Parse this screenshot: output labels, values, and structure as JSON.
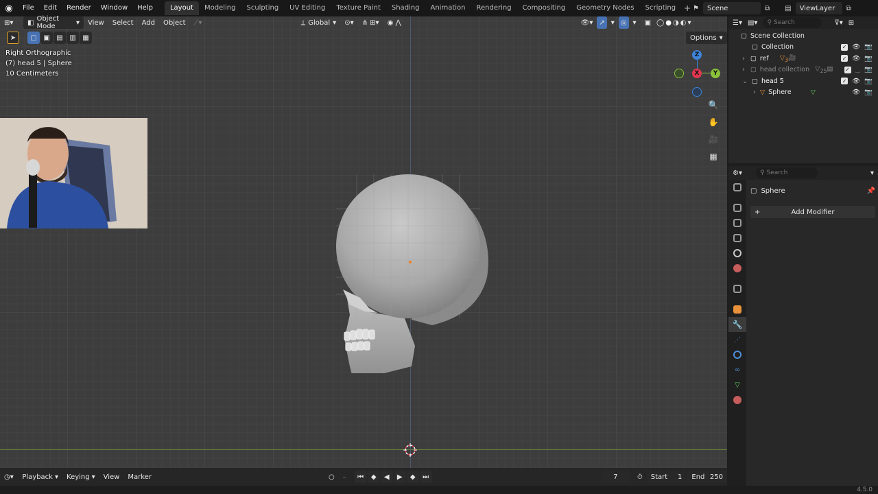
{
  "menu": [
    "File",
    "Edit",
    "Render",
    "Window",
    "Help"
  ],
  "workspaces": [
    "Layout",
    "Modeling",
    "Sculpting",
    "UV Editing",
    "Texture Paint",
    "Shading",
    "Animation",
    "Rendering",
    "Compositing",
    "Geometry Nodes",
    "Scripting"
  ],
  "active_workspace": "Layout",
  "scene": "Scene",
  "view_layer": "ViewLayer",
  "viewport": {
    "mode": "Object Mode",
    "menus": [
      "View",
      "Select",
      "Add",
      "Object"
    ],
    "orientation": "Global",
    "options_label": "Options",
    "overlay_lines": [
      "Right Orthographic",
      "(7) head 5 | Sphere",
      "10 Centimeters"
    ],
    "gizmo": {
      "z": "Z",
      "x": "X",
      "y": "Y"
    }
  },
  "timeline": {
    "menus": [
      "Playback",
      "Keying",
      "View",
      "Marker"
    ],
    "current_frame": "7",
    "start_label": "Start",
    "start": "1",
    "end_label": "End",
    "end": "250"
  },
  "version": "4.5.0",
  "outliner": {
    "search_placeholder": "Search",
    "rows": [
      {
        "label": "Scene Collection"
      },
      {
        "label": "Collection"
      },
      {
        "label": "ref",
        "badge": "3"
      },
      {
        "label": "head collection",
        "badge": "25"
      },
      {
        "label": "head 5"
      },
      {
        "label": "Sphere"
      }
    ]
  },
  "properties": {
    "search_placeholder": "Search",
    "object_name": "Sphere",
    "add_modifier": "Add Modifier",
    "tab_colors": [
      "#9a9a9a",
      "#9a9a9a",
      "#9a9a9a",
      "#9a9a9a",
      "#c9c9c9",
      "#c75c5c",
      "#9a9a9a",
      "#e8903a",
      "#4e8fd9",
      "#4e8fd9",
      "#4e8fd9",
      "#4e8fd9",
      "#5ac05a",
      "#c75c5c"
    ]
  },
  "colors": {
    "accent": "#4772b3",
    "x_axis": "#e0364f",
    "y_axis": "#89c13a",
    "z_axis": "#3d84d9"
  }
}
